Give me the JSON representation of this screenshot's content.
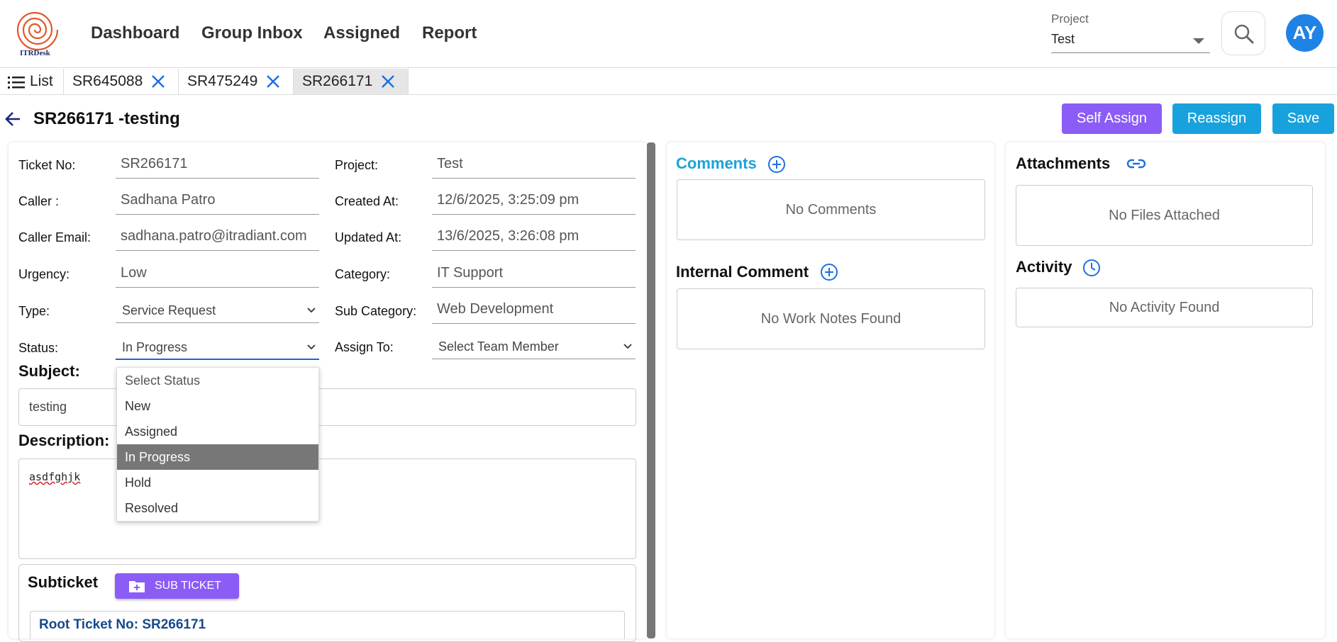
{
  "brand": {
    "logo_text": "ITRDesk",
    "logo_color": "#e0572a"
  },
  "nav": {
    "items": [
      "Dashboard",
      "Group Inbox",
      "Assigned",
      "Report"
    ]
  },
  "project_selector": {
    "label": "Project",
    "value": "Test"
  },
  "user": {
    "initials": "AY"
  },
  "tabs": {
    "list_label": "List",
    "open": [
      "SR645088",
      "SR475249",
      "SR266171"
    ],
    "active_index": 2
  },
  "ticket": {
    "title": "SR266171 -testing"
  },
  "actions": {
    "self_assign": "Self Assign",
    "reassign": "Reassign",
    "save": "Save",
    "colors": {
      "self_assign": "#8b5cf6",
      "reassign": "#18a2dd",
      "save": "#18a2dd"
    }
  },
  "form": {
    "left": [
      {
        "label": "Ticket No:",
        "value": "SR266171"
      },
      {
        "label": "Caller :",
        "value": "Sadhana Patro"
      },
      {
        "label": "Caller Email:",
        "value": "sadhana.patro@itradiant.com"
      },
      {
        "label": "Urgency:",
        "value": "Low"
      },
      {
        "label": "Type:",
        "value": "Service Request"
      },
      {
        "label": "Status:",
        "value": "In Progress"
      }
    ],
    "right": [
      {
        "label": "Project:",
        "value": "Test"
      },
      {
        "label": "Created At:",
        "value": "12/6/2025, 3:25:09 pm"
      },
      {
        "label": "Updated At:",
        "value": "13/6/2025, 3:26:08 pm"
      },
      {
        "label": "Category:",
        "value": "IT Support"
      },
      {
        "label": "Sub Category:",
        "value": "Web Development"
      },
      {
        "label": "Assign To:",
        "value": "Select Team Member"
      }
    ],
    "subject_label": "Subject:",
    "subject_value": "testing",
    "description_label": "Description:",
    "description_value": "asdfghjk"
  },
  "status_dropdown": {
    "options": [
      "Select Status",
      "New",
      "Assigned",
      "In Progress",
      "Hold",
      "Resolved"
    ],
    "selected": "In Progress"
  },
  "subticket": {
    "heading": "Subticket",
    "button": "SUB TICKET",
    "root_label": "Root Ticket No: SR266171"
  },
  "comments": {
    "heading": "Comments",
    "empty": "No Comments"
  },
  "internal": {
    "heading": "Internal Comment",
    "empty": "No Work Notes Found"
  },
  "attachments": {
    "heading": "Attachments",
    "empty": "No Files Attached"
  },
  "activity": {
    "heading": "Activity",
    "empty": "No Activity Found"
  }
}
